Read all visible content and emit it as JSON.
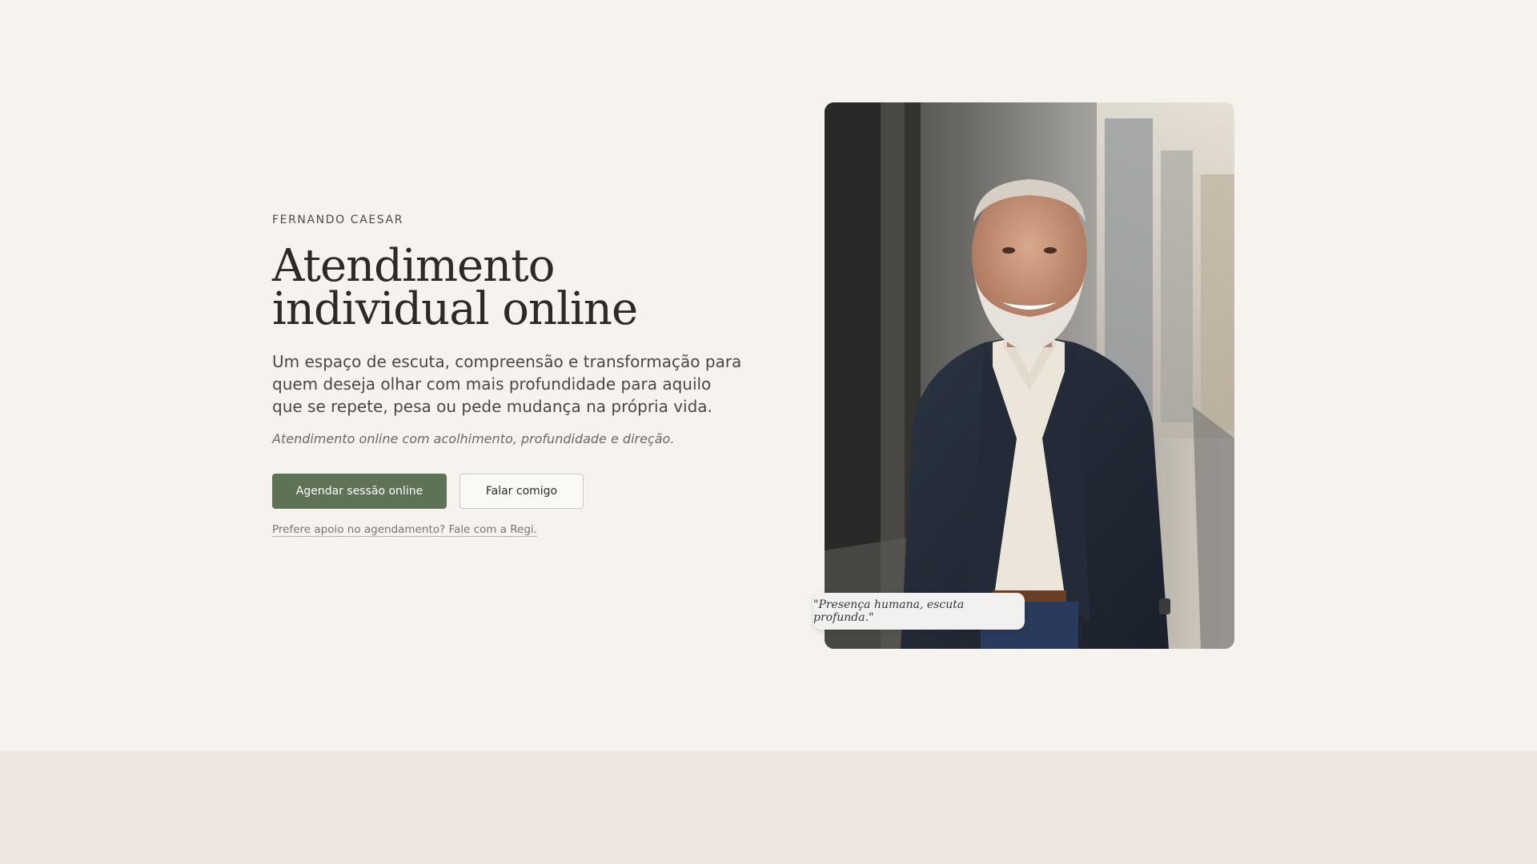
{
  "hero": {
    "eyebrow": "FERNANDO CAESAR",
    "title": "Atendimento individual online",
    "lead": "Um espaço de escuta, compreensão e transformação para quem deseja olhar com mais profundidade para aquilo que se repete, pesa ou pede mudança na própria vida.",
    "tagline": "Atendimento online com acolhimento, profundidade e direção.",
    "primary_button": "Agendar sessão online",
    "secondary_button": "Falar comigo",
    "support_link": "Prefere apoio no agendamento? Fale com a Regi."
  },
  "portrait": {
    "quote": "\"Presença humana, escuta profunda.\""
  },
  "colors": {
    "background": "#f6f3ee",
    "lower_section": "#efe6e1",
    "accent_green": "#5e7356",
    "text_dark": "#2d2a26"
  }
}
